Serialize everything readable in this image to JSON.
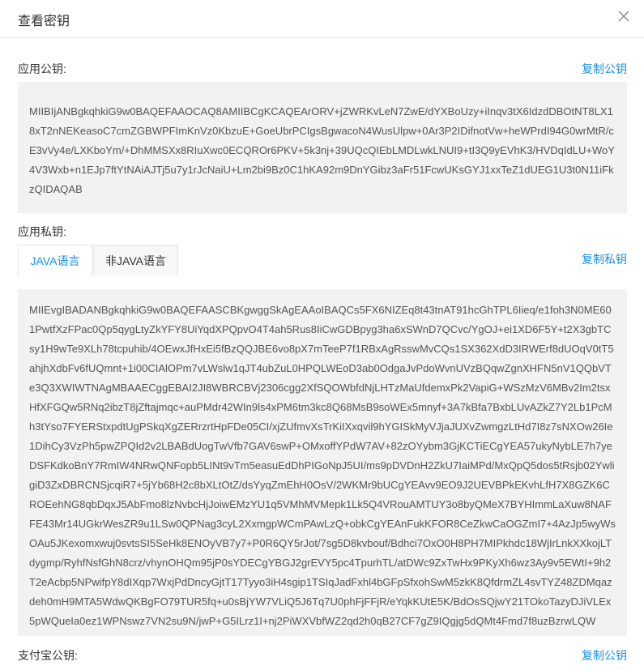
{
  "dialog": {
    "title": "查看密钥"
  },
  "public_key": {
    "label": "应用公钥:",
    "copy_label": "复制公钥",
    "value": "MIIBIjANBgkqhkiG9w0BAQEFAAOCAQ8AMIIBCgKCAQEArORV+jZWRKvLeN7ZwE/dYXBoUzy+iInqv3tX6IdzdDBOtNT8LX18xT2nNEKeasoC7cmZGBWPFImKnVz0KbzuE+GoeUbrPCIgsBgwacoN4WusUlpw+0Ar3P2IDifnotVw+heWPrdI94G0wrMtR/cE3vVy4e/LXKboYm/+DhMMSXx8RIuXwc0ECQROr6PKV+5k3nj+39UQcQIEbLMDLwkLNUI9+tI3Q9yEVhK3/HVDqIdLU+WoY4V3Wxb+n1EJp7ftYtNAiAJTj5u7y1rJcNaiU+Lm2bi9Bz0C1hKA92m9DnYGibz3aFr51FcwUKsGYJ1xxTeZ1dUEG1U3t0N11iFkzQIDAQAB"
  },
  "private_key": {
    "label": "应用私钥:",
    "copy_label": "复制私钥",
    "tabs": [
      {
        "label": "JAVA语言",
        "active": true
      },
      {
        "label": "非JAVA语言",
        "active": false
      }
    ],
    "value": "MIIEvgIBADANBgkqhkiG9w0BAQEFAASCBKgwggSkAgEAAoIBAQCs5FX6NIZEq8t43tnAT91hcGhTPL6Iieq/e1foh3N0ME601PwtfXzFPac0Qp5qygLtyZkYFY8UiYqdXPQpvO4T4ah5Rus8IiCwGDBpyg3ha6xSWnD7QCvc/YgOJ+ei1XD6F5Y+t2X3gbTCsy1H9wTe9XLh78tcpuhib/4OEwxJfHxEi5fBzQQJBE6vo8pX7mTeeP7f1RBxAgRsswMvCQs1SX362XdD3IRWErf8dUOqV0tT5ahjhXdbFv6fUQmnt+1i00CIAlOPm7vLWslw1qJT4ubZuL0HPQLWEoD3ab0OdgaJvPdoWvnUVzBQqwZgnXHFN5nV1QQbVTe3Q3XWIWTNAgMBAAECggEBAI2JI8WBRCBVj2306cgg2XfSQOWbfdNjLHTzMaUfdemxPk2VapiG+WSzMzV6MBv2Im2tsxHfXFGQw5RNq2ibzT8jZftajmqc+auPMdr42WIn9ls4xPM6tm3kc8Q68MsB9soWEx5mnyf+3A7kBfa7BxbLUvAZkZ7Y2Lb1PcMh3tYso7FYERStxpdtUgPSkqXgZERrzrtHpFDe05CI/xjZUfmvXsTrKiIXxqvil9hYGISkMyVJjaJUXvZwmgzLtHd7I8z7sNXOw26Ie1DihCy3VzPh5pwZPQId2v2LBABdUogTwVfb7GAV6swP+OMxoffYPdW7AV+82zOYybm3GjKCTiECgYEA57ukyNybLE7h7yeDSFKdkoBnY7RmIW4NRwQNFopb5LINt9vTm5easuEdDhPIGoNpJ5UI/ms9pDVDnH2ZkU7IaiMPd/MxQpQ5dos5tRsjb02YwligiD3ZxDBRCNSjcqiR7+5jYb68H2c8bXLtOtZ/dsYyqZmEhH0OsV/2WKMr9bUCgYEAvv9EO9J2UEVBPkEKvhLfH7X8GZK6CROEehNG8qbDqxJ5AbFmo8lzNvbcHjJoiwEMzYU1q5VMhMVMepk1Lk5Q4VRouAMTUY3o8byQMeX7BYHImmLaXuw8NAFFE43Mr14UGkrWesZR9u1LSw0QPNag3cyL2XxmgpWCmPAwLzQ+obkCgYEAnFukKFOR8CeZkwCaOGZmI7+4AzJp5wyWsOAu5JKexomxwuj0svtsSI5SeHk8ENOyVB7y7+P0R6QY5rJot/7sg5D8kvbouf/Bdhci7OxO0H8PH7MIPkhdc18WjIrLnkXXkojLTdygmp/RyhfNsfGhN8crz/vhynOHQm95jP0sYDECgYBGJ2grEVY5pc4TpurhTL/atDWc9ZxTwHx9PKyXh6wz3Ay9v5EWtI+9h2T2eAcbp5NPwifpY8dIXqp7WxjPdDncyGjtT17Tyyo3iH4sgip1TSIqJadFxhl4bGFpSfxohSwM5zkK8QfdrmZL4svTYZ48ZDMqazdeh0mH9MTA5WdwQKBgFO79TUR5fq+u0sBjYW7VLiQ5J6Tq7U0phFjFFjR/eYqkKUtE5K/BdOsSQjwY21TOkoTazyDJiVLEx5pWQueIa0ez1WPNswz7VN2su9N/jwP+G5ILrz1I+nj2PiWXVbfWZ2qd2h0qB27CF7gZ9IQgjg5dQMt4Fmd7f8uzBzrwLQW"
  },
  "alipay_key": {
    "label": "支付宝公钥:",
    "copy_label": "复制公钥"
  }
}
